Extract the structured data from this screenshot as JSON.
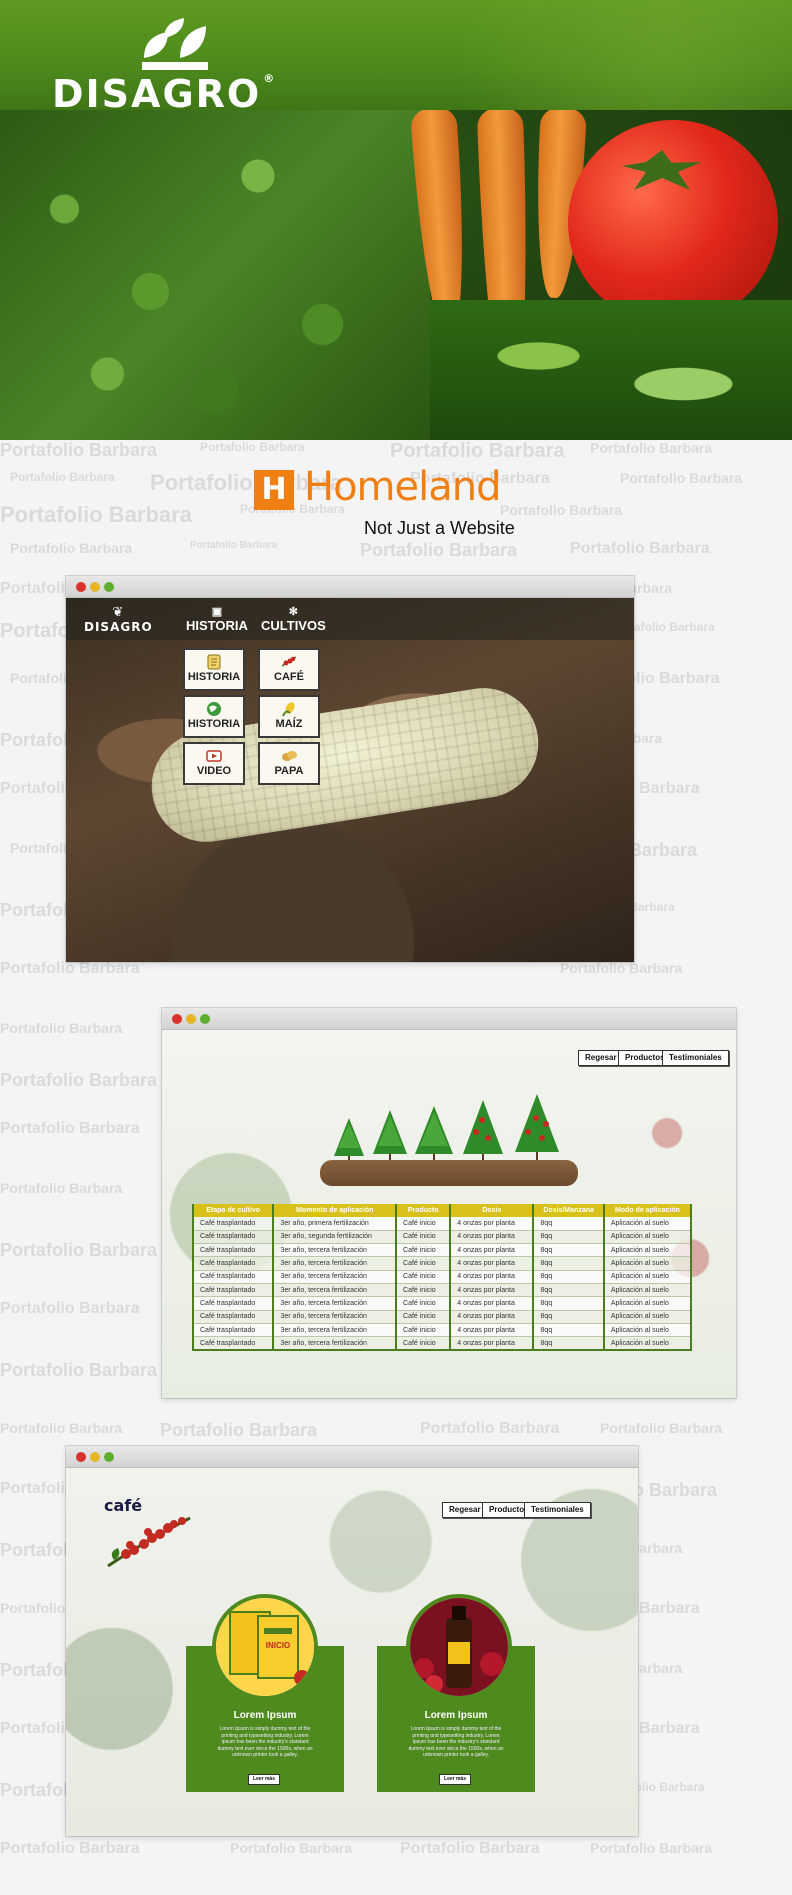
{
  "hero": {
    "brand": "DISAGRO",
    "brand_mark": "®"
  },
  "watermark_text": "Portafolio Barbara",
  "homeland": {
    "letter": "H",
    "name": "Homeland",
    "tagline": "Not Just a Website"
  },
  "window1": {
    "logo": "DISAGRO",
    "nav": [
      {
        "label": "HISTORIA",
        "icon": "book-icon"
      },
      {
        "label": "CULTIVOS",
        "icon": "sprout-icon"
      }
    ],
    "tiles": [
      {
        "label": "HISTORIA",
        "icon": "scroll-icon"
      },
      {
        "label": "CAFÉ",
        "icon": "coffee-branch-icon"
      },
      {
        "label": "HISTORIA",
        "icon": "globe-icon"
      },
      {
        "label": "MAÍZ",
        "icon": "corn-icon"
      },
      {
        "label": "VIDEO",
        "icon": "video-icon"
      },
      {
        "label": "PAPA",
        "icon": "potato-icon"
      }
    ]
  },
  "window2": {
    "buttons": [
      "Regesar",
      "Productos",
      "Testimoniales"
    ],
    "table": {
      "headers": [
        "Etapa de cultivo",
        "Momento de aplicación",
        "Producto",
        "Dosis",
        "Dosis/Manzana",
        "Modo de aplicación"
      ],
      "rows": [
        [
          "Café trasplantado",
          "3er año, primera fertilización",
          "Café inicio",
          "4 onzas por planta",
          "8qq",
          "Aplicación al suelo"
        ],
        [
          "Café trasplantado",
          "3er año, segunda fertilización",
          "Café inicio",
          "4 onzas por planta",
          "8qq",
          "Aplicación al suelo"
        ],
        [
          "Café trasplantado",
          "3er año, tercera fertilización",
          "Café inicio",
          "4 onzas por planta",
          "8qq",
          "Aplicación al suelo"
        ],
        [
          "Café trasplantado",
          "3er año, tercera fertilización",
          "Café inicio",
          "4 onzas por planta",
          "8qq",
          "Aplicación al suelo"
        ],
        [
          "Café trasplantado",
          "3er año, tercera fertilización",
          "Café inicio",
          "4 onzas por planta",
          "8qq",
          "Aplicación al suelo"
        ],
        [
          "Café trasplantado",
          "3er año, tercera fertilización",
          "Café inicio",
          "4 onzas por planta",
          "8qq",
          "Aplicación al suelo"
        ],
        [
          "Café trasplantado",
          "3er año, tercera fertilización",
          "Café inicio",
          "4 onzas por planta",
          "8qq",
          "Aplicación al suelo"
        ],
        [
          "Café trasplantado",
          "3er año, tercera fertilización",
          "Café inicio",
          "4 onzas por planta",
          "8qq",
          "Aplicación al suelo"
        ],
        [
          "Café trasplantado",
          "3er año, tercera fertilización",
          "Café inicio",
          "4 onzas por planta",
          "8qq",
          "Aplicación al suelo"
        ],
        [
          "Café trasplantado",
          "3er año, tercera fertilización",
          "Café inicio",
          "4 onzas por planta",
          "8qq",
          "Aplicación al suelo"
        ]
      ]
    }
  },
  "window3": {
    "title": "café",
    "buttons": [
      "Regesar",
      "Productos",
      "Testimoniales"
    ],
    "cards": [
      {
        "title": "Lorem Ipsum",
        "text": "Lorem Ipsum is simply dummy text of the printing and typesetting industry. Lorem Ipsum has been the industry's standard dummy text ever since the 1500s, when an unknown printer took a galley.",
        "button": "Leer más",
        "product": "INICIO"
      },
      {
        "title": "Lorem Ipsum",
        "text": "Lorem Ipsum is simply dummy text of the printing and typesetting industry. Lorem Ipsum has been the industry's standard dummy text ever since the 1500s, when an unknown printer took a galley.",
        "button": "Leer más",
        "product": ""
      }
    ]
  },
  "colors": {
    "brand_green": "#4f8a1e",
    "homeland_orange": "#f07f13",
    "table_header": "#d8c21a"
  }
}
